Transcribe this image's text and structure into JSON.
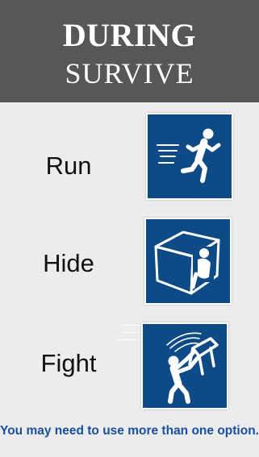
{
  "header": {
    "title": "DURING",
    "subtitle": "SURVIVE"
  },
  "actions": [
    {
      "label": "Run",
      "icon": "running-person-icon"
    },
    {
      "label": "Hide",
      "icon": "person-hiding-behind-box-icon"
    },
    {
      "label": "Fight",
      "icon": "person-throwing-chair-icon"
    }
  ],
  "footer": {
    "note": "You may need to use more than one option."
  },
  "colors": {
    "header_bg": "#575757",
    "sign_blue": "#0d4a86",
    "footer_text": "#1a4f9a",
    "background": "#ececee"
  }
}
